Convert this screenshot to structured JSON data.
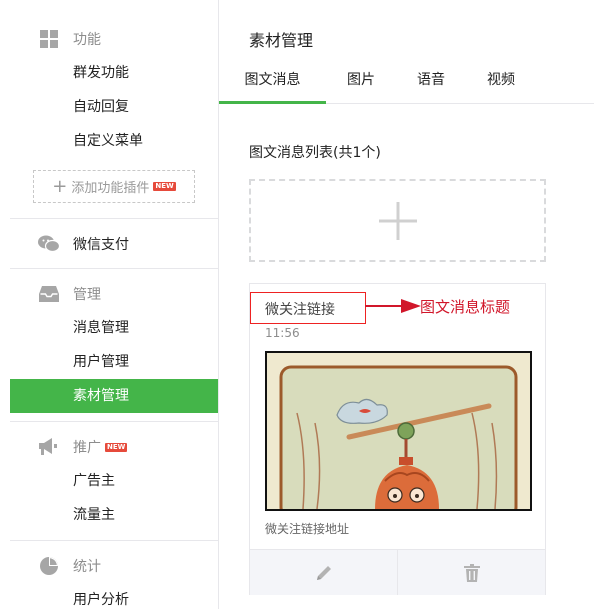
{
  "sidebar": {
    "groups": [
      {
        "label": "功能",
        "icon": "grid-icon",
        "items": [
          "群发功能",
          "自动回复",
          "自定义菜单"
        ]
      },
      {
        "label": "微信支付",
        "icon": "wechat-icon",
        "items": []
      },
      {
        "label": "管理",
        "icon": "inbox-icon",
        "items": [
          "消息管理",
          "用户管理",
          "素材管理"
        ]
      },
      {
        "label": "推广",
        "icon": "megaphone-icon",
        "badge": "NEW",
        "items": [
          "广告主",
          "流量主"
        ]
      },
      {
        "label": "统计",
        "icon": "pie-chart-icon",
        "items": [
          "用户分析"
        ]
      }
    ],
    "add_plugin": {
      "label": "添加功能插件",
      "badge": "NEW"
    },
    "active_item": "素材管理"
  },
  "main": {
    "title": "素材管理",
    "tabs": [
      "图文消息",
      "图片",
      "语音",
      "视频"
    ],
    "active_tab": "图文消息",
    "list_title": "图文消息列表(共1个)",
    "card": {
      "title": "微关注链接",
      "time": "11:56",
      "description": "微关注链接地址"
    }
  },
  "annotation": {
    "label": "图文消息标题"
  },
  "colors": {
    "accent": "#44b549",
    "annotation": "#d1162a",
    "badge": "#e64a3b"
  }
}
